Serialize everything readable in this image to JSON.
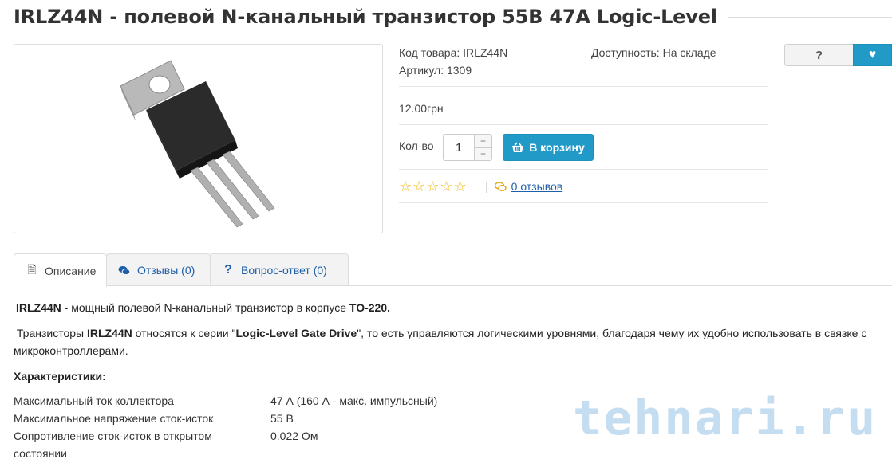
{
  "product": {
    "title": "IRLZ44N - полевой N-канальный транзистор 55В 47А Logic-Level",
    "code_label": "Код товара:",
    "code_value": "IRLZ44N",
    "availability_label": "Доступность:",
    "availability_value": "На складе",
    "article_label": "Артикул:",
    "article_value": "1309",
    "price": "12.00грн",
    "qty_label": "Кол-во",
    "qty_value": "1",
    "qty_plus": "+",
    "qty_minus": "−",
    "cart_label": "В корзину",
    "rating_stars": 0,
    "reviews_link": "0 отзывов"
  },
  "actions": {
    "question_label": "?"
  },
  "tabs": [
    {
      "label": "Описание",
      "icon": "document-icon"
    },
    {
      "label": "Отзывы (0)",
      "icon": "comments-icon"
    },
    {
      "label": "Вопрос-ответ (0)",
      "icon": "question-icon"
    }
  ],
  "description": {
    "p1_bold": "IRLZ44N",
    "p1_text": " - мощный полевой N-канальный транзистор в корпусе ",
    "p1_bold2": "TO-220.",
    "p2_a": "Транзисторы ",
    "p2_bold": "IRLZ44N",
    "p2_b": " относятся к серии \"",
    "p2_bold2": "Logic-Level Gate Drive",
    "p2_c": "\", то есть управляются логическими уровнями, благодаря чему их удобно использовать в связке с микроконтроллерами.",
    "characteristics_heading": "Характеристики:",
    "specs": [
      {
        "name": "Максимальный ток коллектора",
        "value": "47 А (160 А - макс. импульсный)"
      },
      {
        "name": "Максимальное напряжение сток-исток",
        "value": "55 В"
      },
      {
        "name": "Сопротивление сток-исток в открытом",
        "value": "0.022 Ом"
      },
      {
        "name": "состоянии",
        "value": ""
      }
    ]
  },
  "watermark": "tehnari.ru"
}
